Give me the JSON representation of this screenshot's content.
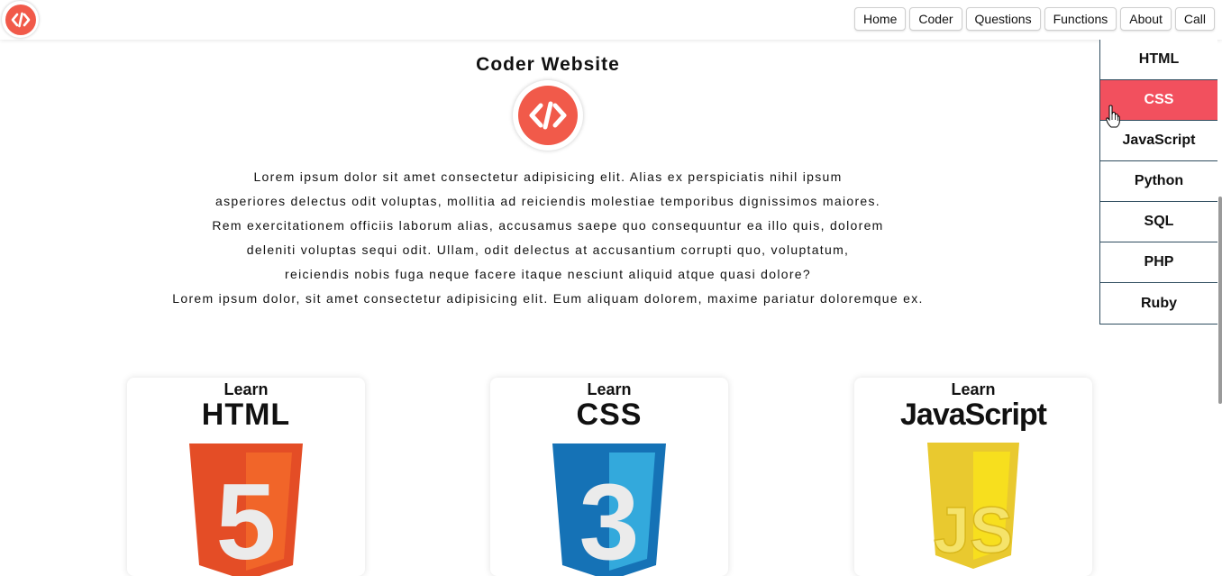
{
  "nav": {
    "items": [
      "Home",
      "Coder",
      "Questions",
      "Functions",
      "About",
      "Call"
    ]
  },
  "side_menu": {
    "items": [
      "HTML",
      "CSS",
      "JavaScript",
      "Python",
      "SQL",
      "PHP",
      "Ruby"
    ],
    "active": "CSS"
  },
  "hero": {
    "title": "Coder Website",
    "paragraph_lines": [
      "Lorem ipsum dolor sit amet consectetur adipisicing elit. Alias ex perspiciatis nihil ipsum",
      "asperiores delectus odit voluptas, mollitia ad reiciendis molestiae temporibus dignissimos maiores.",
      "Rem exercitationem officiis laborum alias, accusamus saepe quo consequuntur ea illo quis, dolorem",
      "deleniti voluptas sequi odit. Ullam, odit delectus at accusantium corrupti quo, voluptatum,",
      "reiciendis nobis fuga neque facere itaque nesciunt aliquid atque quasi dolore?",
      "Lorem ipsum dolor, sit amet consectetur adipisicing elit. Eum aliquam dolorem, maxime pariatur doloremque ex."
    ]
  },
  "cards": [
    {
      "learn": "Learn",
      "tech": "HTML",
      "number": "5"
    },
    {
      "learn": "Learn",
      "tech": "CSS",
      "number": "3"
    },
    {
      "learn": "Learn",
      "tech": "JavaScript",
      "number": "JS"
    }
  ],
  "icons": {
    "logo": "code-brackets-icon",
    "cursor": "hand-pointer-icon"
  },
  "colors": {
    "brand_red": "#f15a4a",
    "active_menu": "#f2505e",
    "menu_border": "#2f4d5f",
    "html_orange": "#e44d26",
    "css_blue": "#1572b6",
    "js_yellow": "#f0db4f"
  }
}
